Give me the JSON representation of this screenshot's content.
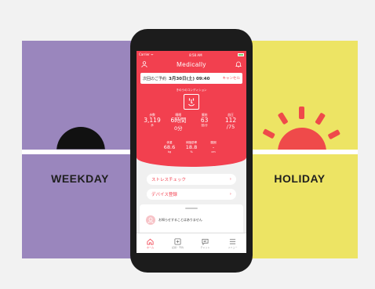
{
  "panels": {
    "left_label": "WEEKDAY",
    "right_label": "HOLIDAY",
    "left_color": "#9a86bd",
    "right_color": "#ede464",
    "sun_color": "#ef4a4a"
  },
  "status_bar": {
    "carrier": "Carrier ᯤ",
    "time": "8:58 AM"
  },
  "app": {
    "title": "Medically",
    "accent": "#f2404f",
    "left_icon": "user-icon",
    "right_icon": "bell-icon"
  },
  "appointment": {
    "prefix": "次回のご予約",
    "date": "3月30日(土) 09:40",
    "cancel": "キャンセル"
  },
  "today_label": "きのうのコンディション",
  "stats": [
    {
      "label": "歩数",
      "value": "3,119",
      "unit": "歩"
    },
    {
      "label": "睡眠",
      "value": "6時間",
      "sub": "0分"
    },
    {
      "label": "脈拍",
      "value": "63",
      "unit": "回/分"
    },
    {
      "label": "血圧",
      "value": "112",
      "sub": "/75"
    }
  ],
  "stats2": [
    {
      "label": "体重",
      "value": "68.6",
      "unit": "kg"
    },
    {
      "label": "体脂肪率",
      "value": "18.8",
      "unit": "%"
    },
    {
      "label": "腹囲",
      "value": "-",
      "unit": "cm"
    }
  ],
  "menu": [
    {
      "label": "ストレスチェック",
      "chevron": "›"
    },
    {
      "label": "デバイス登録",
      "chevron": "›"
    }
  ],
  "notice": "お知らせすることはありません",
  "tabs": [
    {
      "label": "ホーム",
      "icon": "home-icon"
    },
    {
      "label": "記録・予約",
      "icon": "plus-square-icon"
    },
    {
      "label": "チャット",
      "icon": "chat-icon"
    },
    {
      "label": "メニュー",
      "icon": "menu-icon"
    }
  ]
}
